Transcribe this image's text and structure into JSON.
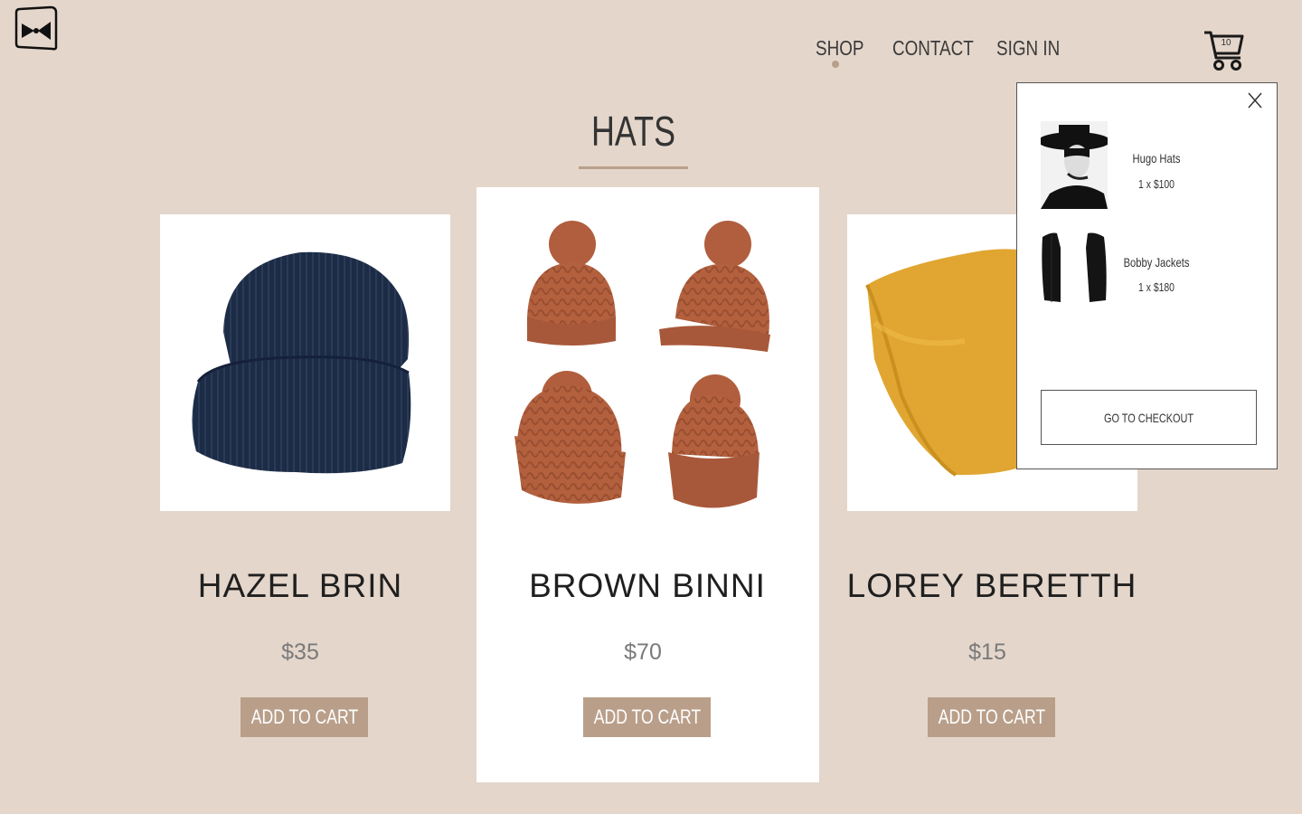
{
  "brand": {
    "logo_icon": "bowtie-logo-icon"
  },
  "nav": {
    "items": [
      {
        "label": "SHOP",
        "active": true
      },
      {
        "label": "CONTACT",
        "active": false
      },
      {
        "label": "SIGN IN",
        "active": false
      }
    ]
  },
  "cart": {
    "icon": "shopping-cart-icon",
    "count": "10"
  },
  "page": {
    "title": "HATS"
  },
  "colors": {
    "background": "#e4d6cb",
    "accent": "#b99f8a",
    "card": "#ffffff"
  },
  "products": [
    {
      "name": "HAZEL BRIN",
      "price": "$35",
      "button": "ADD TO CART",
      "image": "navy-beanie-image"
    },
    {
      "name": "BROWN BINNI",
      "price": "$70",
      "button": "ADD TO CART",
      "image": "brown-pompom-beanies-image"
    },
    {
      "name": "LOREY BERETTH",
      "price": "$15",
      "button": "ADD TO CART",
      "image": "yellow-beanie-image"
    }
  ],
  "cart_dropdown": {
    "close_icon": "close-icon",
    "items": [
      {
        "name": "Hugo Hats",
        "qty": "1 x $100",
        "image": "woman-black-hat-image"
      },
      {
        "name": "Bobby Jackets",
        "qty": "1 x $180",
        "image": "black-jacket-image"
      }
    ],
    "checkout_label": "GO TO CHECKOUT"
  }
}
